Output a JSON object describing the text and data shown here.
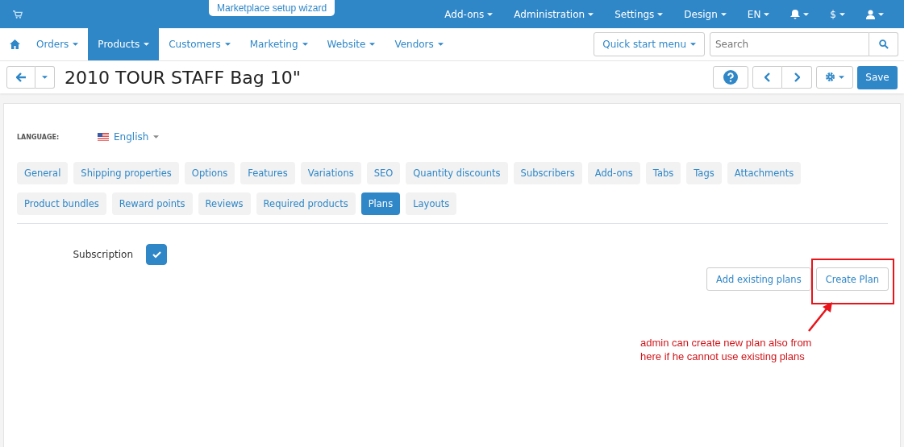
{
  "top_bar": {
    "wizard_button": "Marketplace setup wizard",
    "menus": [
      {
        "kind": "text",
        "label": "Add-ons"
      },
      {
        "kind": "text",
        "label": "Administration"
      },
      {
        "kind": "text",
        "label": "Settings"
      },
      {
        "kind": "text",
        "label": "Design"
      },
      {
        "kind": "text",
        "label": "EN"
      },
      {
        "kind": "bell"
      },
      {
        "kind": "text",
        "label": "$"
      },
      {
        "kind": "user"
      }
    ]
  },
  "nav": {
    "items": [
      {
        "label": "Orders",
        "selected": false
      },
      {
        "label": "Products",
        "selected": true
      },
      {
        "label": "Customers",
        "selected": false
      },
      {
        "label": "Marketing",
        "selected": false
      },
      {
        "label": "Website",
        "selected": false
      },
      {
        "label": "Vendors",
        "selected": false
      }
    ],
    "quick_start": "Quick start menu",
    "search": {
      "placeholder": "Search"
    }
  },
  "toolbar": {
    "title": "2010 TOUR STAFF Bag 10\"",
    "save": "Save"
  },
  "language": {
    "label": "LANGUAGE:",
    "value": "English"
  },
  "tab_rows": [
    [
      {
        "label": "General",
        "selected": false
      },
      {
        "label": "Shipping properties",
        "selected": false
      },
      {
        "label": "Options",
        "selected": false
      },
      {
        "label": "Features",
        "selected": false
      },
      {
        "label": "Variations",
        "selected": false
      },
      {
        "label": "SEO",
        "selected": false
      },
      {
        "label": "Quantity discounts",
        "selected": false
      },
      {
        "label": "Subscribers",
        "selected": false
      },
      {
        "label": "Add-ons",
        "selected": false
      },
      {
        "label": "Tabs",
        "selected": false
      },
      {
        "label": "Tags",
        "selected": false
      },
      {
        "label": "Attachments",
        "selected": false
      }
    ],
    [
      {
        "label": "Product bundles",
        "selected": false
      },
      {
        "label": "Reward points",
        "selected": false
      },
      {
        "label": "Reviews",
        "selected": false
      },
      {
        "label": "Required products",
        "selected": false
      },
      {
        "label": "Plans",
        "selected": true
      },
      {
        "label": "Layouts",
        "selected": false
      }
    ]
  ],
  "subscription": {
    "label": "Subscription",
    "checked": true
  },
  "plan_buttons": [
    "Add existing plans",
    "Create Plan"
  ],
  "annotation": {
    "text": "admin can create new plan also from here if he cannot use existing plans"
  }
}
